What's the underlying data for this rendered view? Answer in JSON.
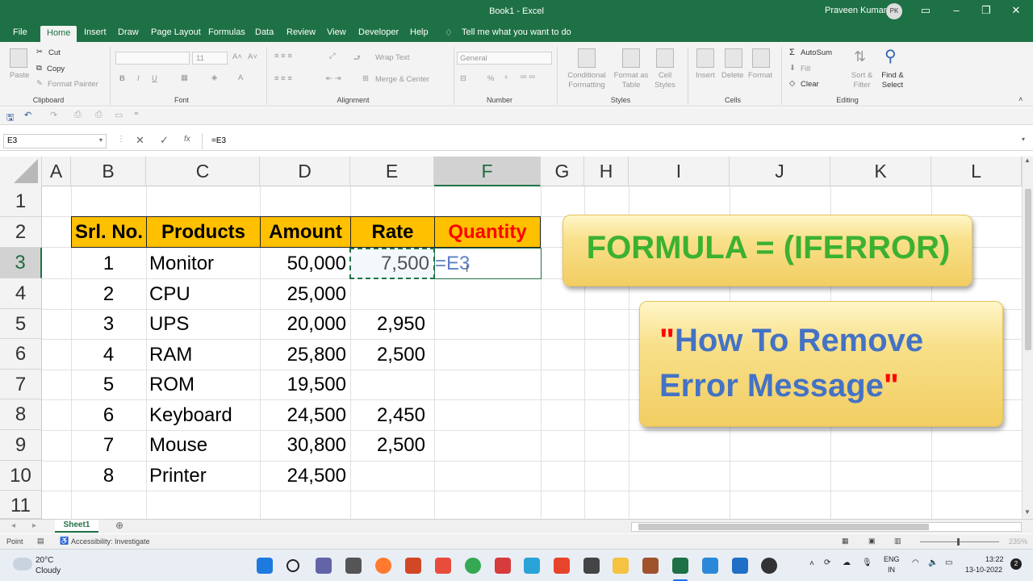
{
  "window": {
    "title": "Book1  -  Excel",
    "user": "Praveen Kumar",
    "user_initials": "PK"
  },
  "menu": {
    "tabs": [
      "File",
      "Home",
      "Insert",
      "Draw",
      "Page Layout",
      "Formulas",
      "Data",
      "Review",
      "View",
      "Developer",
      "Help"
    ],
    "active": "Home",
    "tell_me": "Tell me what you want to do"
  },
  "ribbon": {
    "clipboard": {
      "paste": "Paste",
      "cut": "Cut",
      "copy": "Copy",
      "format_painter": "Format Painter",
      "label": "Clipboard"
    },
    "font": {
      "size": "11",
      "label": "Font",
      "bold": "B",
      "italic": "I",
      "underline": "U"
    },
    "alignment": {
      "wrap_text": "Wrap Text",
      "merge_center": "Merge & Center",
      "label": "Alignment"
    },
    "number": {
      "format": "General",
      "label": "Number",
      "percent": "%"
    },
    "styles": {
      "conditional_formatting": [
        "Conditional",
        "Formatting"
      ],
      "format_as_table": [
        "Format as",
        "Table"
      ],
      "cell_styles": [
        "Cell",
        "Styles"
      ],
      "label": "Styles"
    },
    "cells": {
      "insert": "Insert",
      "delete": "Delete",
      "format": "Format",
      "label": "Cells"
    },
    "editing": {
      "autosum": "AutoSum",
      "fill": "Fill",
      "clear": "Clear",
      "sort_filter": [
        "Sort &",
        "Filter"
      ],
      "find_select": [
        "Find &",
        "Select"
      ],
      "label": "Editing"
    }
  },
  "formula_bar": {
    "name_box": "E3",
    "formula": "=E3",
    "fx": "fx"
  },
  "columns": [
    "A",
    "B",
    "C",
    "D",
    "E",
    "F",
    "G",
    "H",
    "I",
    "J",
    "K",
    "L"
  ],
  "rows": [
    "1",
    "2",
    "3",
    "4",
    "5",
    "6",
    "7",
    "8",
    "9",
    "10",
    "11"
  ],
  "table": {
    "headers": [
      "Srl. No.",
      "Products",
      "Amount",
      "Rate",
      "Quantity"
    ],
    "rows": [
      [
        "1",
        "Monitor",
        "50,000",
        "7,500",
        "=E3"
      ],
      [
        "2",
        "CPU",
        "25,000",
        "",
        ""
      ],
      [
        "3",
        "UPS",
        "20,000",
        "2,950",
        ""
      ],
      [
        "4",
        "RAM",
        "25,800",
        "2,500",
        ""
      ],
      [
        "5",
        "ROM",
        "19,500",
        "",
        ""
      ],
      [
        "6",
        "Keyboard",
        "24,500",
        "2,450",
        ""
      ],
      [
        "7",
        "Mouse",
        "30,800",
        "2,500",
        ""
      ],
      [
        "8",
        "Printer",
        "24,500",
        "",
        ""
      ]
    ]
  },
  "shapes": {
    "formula": "FORMULA = (IFERROR)",
    "subtitle_quote_open": "\"",
    "subtitle_line1": "How To Remove",
    "subtitle_line2": "Error Message",
    "subtitle_quote_close": "\""
  },
  "colors": {
    "excel_green": "#1e7145",
    "header_fill": "#ffc000",
    "quantity_text": "#ff0000",
    "formula_green": "#3cb131",
    "subtitle_blue": "#4472c4",
    "quote_red": "#ff0000"
  },
  "sheet": {
    "tab": "Sheet1"
  },
  "status": {
    "mode": "Point",
    "accessibility": "Accessibility: Investigate",
    "zoom": "235%"
  },
  "taskbar": {
    "temp": "20°C",
    "weather": "Cloudy",
    "lang1": "ENG",
    "lang2": "IN",
    "time": "13:22",
    "date": "13-10-2022",
    "notif": "2"
  }
}
